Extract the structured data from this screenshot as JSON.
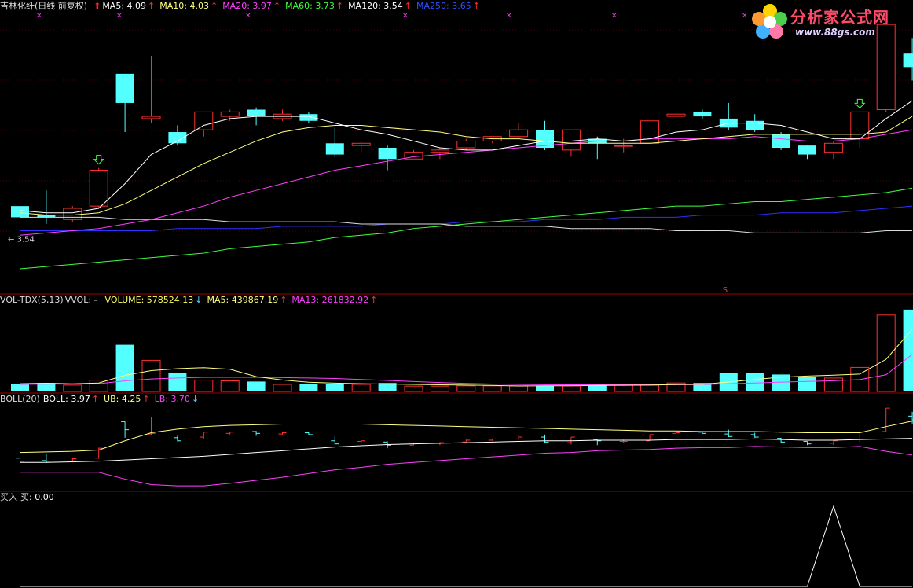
{
  "main_header": {
    "stock": "吉林化纤(日线 前复权)",
    "ma5": "MA5: 4.09",
    "ma10": "MA10: 4.03",
    "ma20": "MA20: 3.97",
    "ma60": "MA60: 3.73",
    "ma120": "MA120: 3.54",
    "ma250": "MA250: 3.65",
    "arrow_up": "↑"
  },
  "vol_header": {
    "name": "VOL-TDX(5,13)",
    "vvol": "VVOL: -",
    "volume": "VOLUME: 578524.13",
    "ma5": "MA5: 439867.19",
    "ma13": "MA13: 261832.92",
    "arrow_dn": "↓",
    "arrow_up": "↑"
  },
  "boll_header": {
    "name": "BOLL(20)",
    "boll": "BOLL: 3.97",
    "ub": "UB: 4.25",
    "lb": "LB: 3.70",
    "arrow_up": "↑",
    "arrow_dn": "↓"
  },
  "buy_header": {
    "name": "买入",
    "value": "买: 0.00"
  },
  "logo": {
    "title": "分析家公式网",
    "url": "www.88gs.com"
  },
  "annotations": {
    "low_price": "3.54",
    "signal_s": "S"
  },
  "colors": {
    "up": "#ff3030",
    "down": "#54ffff",
    "ma5": "#ffffff",
    "ma10": "#ffff80",
    "ma20": "#ff40ff",
    "ma60": "#40ff40",
    "ma120": "#ffffff",
    "ma250": "#3030ff",
    "divider": "#a00000"
  },
  "chart_data": {
    "type": "candlestick",
    "candles": [
      {
        "o": 3.65,
        "c": 3.6,
        "h": 3.66,
        "l": 3.54
      },
      {
        "o": 3.61,
        "c": 3.6,
        "h": 3.72,
        "l": 3.57
      },
      {
        "o": 3.59,
        "c": 3.64,
        "h": 3.65,
        "l": 3.58
      },
      {
        "o": 3.65,
        "c": 3.81,
        "h": 3.82,
        "l": 3.64
      },
      {
        "o": 4.24,
        "c": 4.11,
        "h": 4.24,
        "l": 3.98
      },
      {
        "o": 4.04,
        "c": 4.05,
        "h": 4.32,
        "l": 4.02
      },
      {
        "o": 3.98,
        "c": 3.93,
        "h": 4.01,
        "l": 3.92
      },
      {
        "o": 3.99,
        "c": 4.07,
        "h": 4.07,
        "l": 3.96
      },
      {
        "o": 4.05,
        "c": 4.07,
        "h": 4.08,
        "l": 4.03
      },
      {
        "o": 4.08,
        "c": 4.05,
        "h": 4.09,
        "l": 4.01
      },
      {
        "o": 4.04,
        "c": 4.06,
        "h": 4.08,
        "l": 4.03
      },
      {
        "o": 4.06,
        "c": 4.03,
        "h": 4.07,
        "l": 4.02
      },
      {
        "o": 3.93,
        "c": 3.88,
        "h": 4.0,
        "l": 3.87
      },
      {
        "o": 3.92,
        "c": 3.93,
        "h": 3.94,
        "l": 3.89
      },
      {
        "o": 3.91,
        "c": 3.86,
        "h": 3.92,
        "l": 3.81
      },
      {
        "o": 3.86,
        "c": 3.89,
        "h": 3.9,
        "l": 3.86
      },
      {
        "o": 3.89,
        "c": 3.9,
        "h": 3.91,
        "l": 3.86
      },
      {
        "o": 3.91,
        "c": 3.94,
        "h": 3.95,
        "l": 3.9
      },
      {
        "o": 3.94,
        "c": 3.96,
        "h": 3.96,
        "l": 3.93
      },
      {
        "o": 3.96,
        "c": 3.99,
        "h": 4.02,
        "l": 3.95
      },
      {
        "o": 3.99,
        "c": 3.91,
        "h": 4.03,
        "l": 3.9
      },
      {
        "o": 3.9,
        "c": 3.99,
        "h": 3.99,
        "l": 3.87
      },
      {
        "o": 3.95,
        "c": 3.93,
        "h": 3.96,
        "l": 3.86
      },
      {
        "o": 3.92,
        "c": 3.92,
        "h": 3.95,
        "l": 3.89
      },
      {
        "o": 3.93,
        "c": 4.03,
        "h": 4.03,
        "l": 3.93
      },
      {
        "o": 4.05,
        "c": 4.06,
        "h": 4.06,
        "l": 4.0
      },
      {
        "o": 4.07,
        "c": 4.05,
        "h": 4.08,
        "l": 4.04
      },
      {
        "o": 4.04,
        "c": 4.0,
        "h": 4.11,
        "l": 3.99
      },
      {
        "o": 4.03,
        "c": 3.99,
        "h": 4.06,
        "l": 3.98
      },
      {
        "o": 3.97,
        "c": 3.91,
        "h": 3.98,
        "l": 3.9
      },
      {
        "o": 3.92,
        "c": 3.88,
        "h": 3.92,
        "l": 3.86
      },
      {
        "o": 3.89,
        "c": 3.93,
        "h": 3.94,
        "l": 3.86
      },
      {
        "o": 3.95,
        "c": 4.07,
        "h": 4.07,
        "l": 3.91
      },
      {
        "o": 4.08,
        "c": 4.46,
        "h": 4.46,
        "l": 4.07
      },
      {
        "o": 4.33,
        "c": 4.27,
        "h": 4.4,
        "l": 4.21
      }
    ],
    "ma5": [
      3.63,
      3.62,
      3.62,
      3.64,
      3.75,
      3.88,
      3.94,
      4.01,
      4.04,
      4.05,
      4.05,
      4.05,
      4.02,
      3.99,
      3.97,
      3.94,
      3.91,
      3.9,
      3.9,
      3.92,
      3.94,
      3.94,
      3.95,
      3.94,
      3.95,
      3.98,
      3.99,
      4.02,
      4.02,
      4.01,
      3.98,
      3.95,
      3.95,
      4.04,
      4.12
    ],
    "ma10": [
      3.62,
      3.61,
      3.61,
      3.62,
      3.66,
      3.72,
      3.78,
      3.84,
      3.89,
      3.94,
      3.98,
      4.0,
      4.01,
      4.01,
      4.0,
      3.99,
      3.98,
      3.96,
      3.95,
      3.95,
      3.94,
      3.93,
      3.93,
      3.93,
      3.93,
      3.94,
      3.95,
      3.96,
      3.97,
      3.97,
      3.97,
      3.97,
      3.97,
      3.98,
      4.05
    ],
    "ma20": [
      3.52,
      3.53,
      3.54,
      3.55,
      3.57,
      3.59,
      3.62,
      3.65,
      3.69,
      3.72,
      3.75,
      3.78,
      3.81,
      3.83,
      3.85,
      3.87,
      3.88,
      3.89,
      3.9,
      3.91,
      3.92,
      3.93,
      3.94,
      3.94,
      3.95,
      3.95,
      3.95,
      3.95,
      3.96,
      3.95,
      3.94,
      3.94,
      3.95,
      3.97,
      3.99
    ],
    "ma60": [
      3.37,
      3.38,
      3.39,
      3.4,
      3.41,
      3.42,
      3.43,
      3.44,
      3.46,
      3.47,
      3.48,
      3.49,
      3.51,
      3.52,
      3.53,
      3.55,
      3.56,
      3.57,
      3.58,
      3.59,
      3.6,
      3.61,
      3.62,
      3.63,
      3.64,
      3.65,
      3.65,
      3.66,
      3.67,
      3.67,
      3.68,
      3.69,
      3.7,
      3.71,
      3.73
    ],
    "ma120": [
      3.6,
      3.6,
      3.6,
      3.6,
      3.59,
      3.59,
      3.59,
      3.59,
      3.58,
      3.58,
      3.58,
      3.58,
      3.58,
      3.57,
      3.57,
      3.57,
      3.57,
      3.56,
      3.56,
      3.56,
      3.56,
      3.55,
      3.55,
      3.55,
      3.55,
      3.54,
      3.54,
      3.54,
      3.53,
      3.53,
      3.53,
      3.53,
      3.53,
      3.54,
      3.54
    ],
    "ma250": [
      3.54,
      3.54,
      3.54,
      3.54,
      3.54,
      3.54,
      3.55,
      3.55,
      3.55,
      3.55,
      3.56,
      3.56,
      3.56,
      3.56,
      3.57,
      3.57,
      3.57,
      3.58,
      3.58,
      3.58,
      3.59,
      3.59,
      3.59,
      3.6,
      3.6,
      3.6,
      3.61,
      3.61,
      3.61,
      3.62,
      3.62,
      3.62,
      3.63,
      3.64,
      3.65
    ],
    "volume": [
      55000,
      60000,
      45000,
      80000,
      330000,
      220000,
      130000,
      80000,
      75000,
      70000,
      50000,
      50000,
      50000,
      50000,
      60000,
      38000,
      38000,
      40000,
      40000,
      40000,
      42000,
      40000,
      55000,
      45000,
      45000,
      60000,
      60000,
      130000,
      130000,
      120000,
      100000,
      95000,
      170000,
      540000,
      578524
    ],
    "vol_ma5": [
      55000,
      58000,
      54000,
      60000,
      114000,
      147000,
      161000,
      168000,
      157000,
      105000,
      81000,
      65000,
      59000,
      55000,
      52000,
      50000,
      47000,
      45000,
      43000,
      39000,
      40000,
      40000,
      43000,
      44000,
      45000,
      49000,
      51000,
      67000,
      85000,
      101000,
      109000,
      115000,
      123000,
      227000,
      439867
    ],
    "vol_ma13": [
      50000,
      52000,
      52000,
      55000,
      75000,
      88000,
      95000,
      100000,
      100000,
      100000,
      98000,
      95000,
      92000,
      85000,
      78000,
      70000,
      63000,
      57000,
      53000,
      50000,
      48000,
      47000,
      47000,
      47000,
      47000,
      48000,
      49000,
      54000,
      60000,
      66000,
      71000,
      76000,
      84000,
      118000,
      261832
    ],
    "boll_mid": [
      3.58,
      3.58,
      3.59,
      3.6,
      3.62,
      3.64,
      3.66,
      3.68,
      3.71,
      3.74,
      3.77,
      3.8,
      3.83,
      3.85,
      3.87,
      3.88,
      3.89,
      3.9,
      3.91,
      3.92,
      3.93,
      3.93,
      3.94,
      3.94,
      3.94,
      3.95,
      3.95,
      3.95,
      3.96,
      3.95,
      3.94,
      3.94,
      3.95,
      3.96,
      3.97
    ],
    "boll_ub": [
      3.74,
      3.75,
      3.76,
      3.78,
      3.93,
      4.06,
      4.12,
      4.16,
      4.18,
      4.19,
      4.2,
      4.2,
      4.2,
      4.2,
      4.19,
      4.18,
      4.17,
      4.16,
      4.15,
      4.14,
      4.13,
      4.12,
      4.11,
      4.1,
      4.09,
      4.09,
      4.08,
      4.08,
      4.08,
      4.07,
      4.06,
      4.06,
      4.06,
      4.16,
      4.25
    ],
    "boll_lb": [
      3.42,
      3.42,
      3.42,
      3.42,
      3.31,
      3.22,
      3.2,
      3.2,
      3.24,
      3.29,
      3.34,
      3.4,
      3.46,
      3.5,
      3.55,
      3.58,
      3.61,
      3.64,
      3.67,
      3.7,
      3.73,
      3.74,
      3.77,
      3.78,
      3.79,
      3.81,
      3.82,
      3.82,
      3.84,
      3.83,
      3.82,
      3.82,
      3.84,
      3.76,
      3.7
    ],
    "buy_signal": [
      0,
      0,
      0,
      0,
      0,
      0,
      0,
      0,
      0,
      0,
      0,
      0,
      0,
      0,
      0,
      0,
      0,
      0,
      0,
      0,
      0,
      0,
      0,
      0,
      0,
      0,
      0,
      0,
      0,
      0,
      0,
      1,
      0,
      0,
      0
    ],
    "buy_arrow_indices": [
      3,
      32
    ],
    "s_signal_index": 27,
    "price_range": [
      3.3,
      4.52
    ],
    "volume_range": [
      0,
      600000
    ],
    "boll_range": [
      3.15,
      4.5
    ]
  }
}
